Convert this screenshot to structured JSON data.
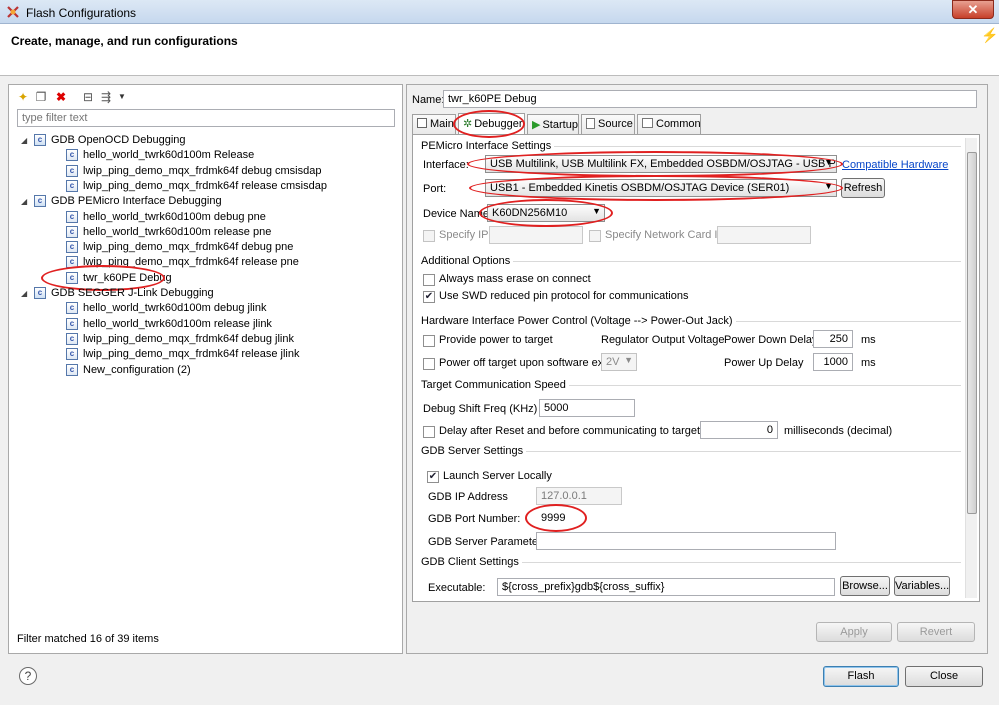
{
  "window": {
    "title": "Flash Configurations",
    "close": "✕"
  },
  "header": {
    "title": "Create, manage, and run configurations"
  },
  "left": {
    "filter_placeholder": "type filter text",
    "status": "Filter matched 16 of 39 items",
    "tree": [
      {
        "label": "GDB OpenOCD Debugging",
        "level": 0,
        "type": "folder"
      },
      {
        "label": "hello_world_twrk60d100m Release",
        "level": 1
      },
      {
        "label": "lwip_ping_demo_mqx_frdmk64f debug cmsisdap",
        "level": 1
      },
      {
        "label": "lwip_ping_demo_mqx_frdmk64f release cmsisdap",
        "level": 1
      },
      {
        "label": "GDB PEMicro Interface Debugging",
        "level": 0,
        "type": "folder"
      },
      {
        "label": "hello_world_twrk60d100m debug pne",
        "level": 1
      },
      {
        "label": "hello_world_twrk60d100m release pne",
        "level": 1
      },
      {
        "label": "lwip_ping_demo_mqx_frdmk64f debug pne",
        "level": 1
      },
      {
        "label": "lwip_ping_demo_mqx_frdmk64f release pne",
        "level": 1
      },
      {
        "label": "twr_k60PE Debug",
        "level": 1,
        "selected": true
      },
      {
        "label": "GDB SEGGER J-Link Debugging",
        "level": 0,
        "type": "folder"
      },
      {
        "label": "hello_world_twrk60d100m debug jlink",
        "level": 1
      },
      {
        "label": "hello_world_twrk60d100m release jlink",
        "level": 1
      },
      {
        "label": "lwip_ping_demo_mqx_frdmk64f debug jlink",
        "level": 1
      },
      {
        "label": "lwip_ping_demo_mqx_frdmk64f release jlink",
        "level": 1
      },
      {
        "label": "New_configuration (2)",
        "level": 1
      }
    ]
  },
  "right": {
    "name_label": "Name:",
    "name_value": "twr_k60PE Debug",
    "tabs": [
      "Main",
      "Debugger",
      "Startup",
      "Source",
      "Common"
    ],
    "active_tab": "Debugger",
    "pemicro": {
      "title": "PEMicro Interface Settings",
      "interface_label": "Interface:",
      "interface_value": "USB Multilink, USB Multilink FX, Embedded OSBDM/OSJTAG - USB Port",
      "compat_link": "Compatible Hardware",
      "port_label": "Port:",
      "port_value": "USB1 - Embedded Kinetis OSBDM/OSJTAG Device (SER01)",
      "refresh": "Refresh",
      "device_label": "Device Name",
      "device_value": "K60DN256M10",
      "specify_ip": "Specify IP",
      "specify_nic": "Specify Network Card IP"
    },
    "additional": {
      "title": "Additional Options",
      "mass_erase": "Always mass erase on connect",
      "mass_erase_checked": false,
      "swd": "Use SWD reduced pin protocol for communications",
      "swd_checked": true
    },
    "power": {
      "title": "Hardware Interface Power Control (Voltage --> Power-Out Jack)",
      "provide": "Provide power to target",
      "regulator": "Regulator Output Voltage",
      "power_down_label": "Power Down Delay",
      "power_down_value": "250",
      "ms1": "ms",
      "power_off": "Power off target upon software exit",
      "voltage": "2V",
      "power_up_label": "Power Up Delay",
      "power_up_value": "1000",
      "ms2": "ms"
    },
    "speed": {
      "title": "Target Communication Speed",
      "shift_label": "Debug Shift Freq (KHz)",
      "shift_value": "5000",
      "delay_label": "Delay after Reset and before communicating to target for",
      "delay_value": "0",
      "delay_unit": "milliseconds (decimal)"
    },
    "server": {
      "title": "GDB Server Settings",
      "launch": "Launch Server Locally",
      "launch_checked": true,
      "ip_label": "GDB IP Address",
      "ip_value": "127.0.0.1",
      "port_label": "GDB Port Number:",
      "port_value": "9999",
      "params_label": "GDB Server Parameters:",
      "params_value": ""
    },
    "client": {
      "title": "GDB Client Settings",
      "exec_label": "Executable:",
      "exec_value": "${cross_prefix}gdb${cross_suffix}",
      "browse": "Browse...",
      "variables": "Variables..."
    },
    "apply": "Apply",
    "revert": "Revert"
  },
  "footer": {
    "flash": "Flash",
    "close": "Close",
    "help": "?"
  },
  "colors": {
    "highlight": "#e02020",
    "link": "#0645c8"
  }
}
